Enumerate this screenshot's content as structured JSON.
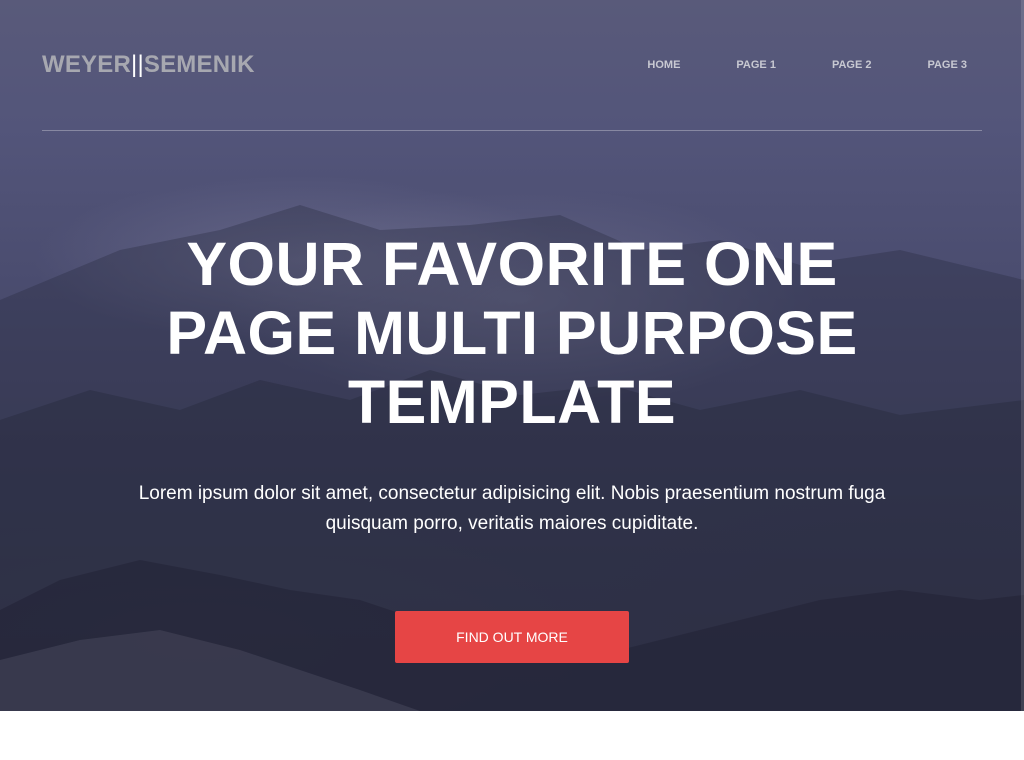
{
  "brand": {
    "left": "WEYER",
    "separator": "||",
    "right": "SEMENIK"
  },
  "nav": {
    "items": [
      {
        "label": "HOME"
      },
      {
        "label": "PAGE 1"
      },
      {
        "label": "PAGE 2"
      },
      {
        "label": "PAGE 3"
      }
    ]
  },
  "hero": {
    "title": "YOUR FAVORITE ONE PAGE MULTI PURPOSE TEMPLATE",
    "lead": "Lorem ipsum dolor sit amet, consectetur adipisicing elit. Nobis praesentium nostrum fuga quisquam porro, veritatis maiores cupiditate.",
    "cta_label": "FIND OUT MORE"
  },
  "colors": {
    "hero_overlay": "#4b4d70",
    "accent": "#e64545",
    "brand_text": "#a7a8b0",
    "nav_text": "#c8c9d2"
  }
}
